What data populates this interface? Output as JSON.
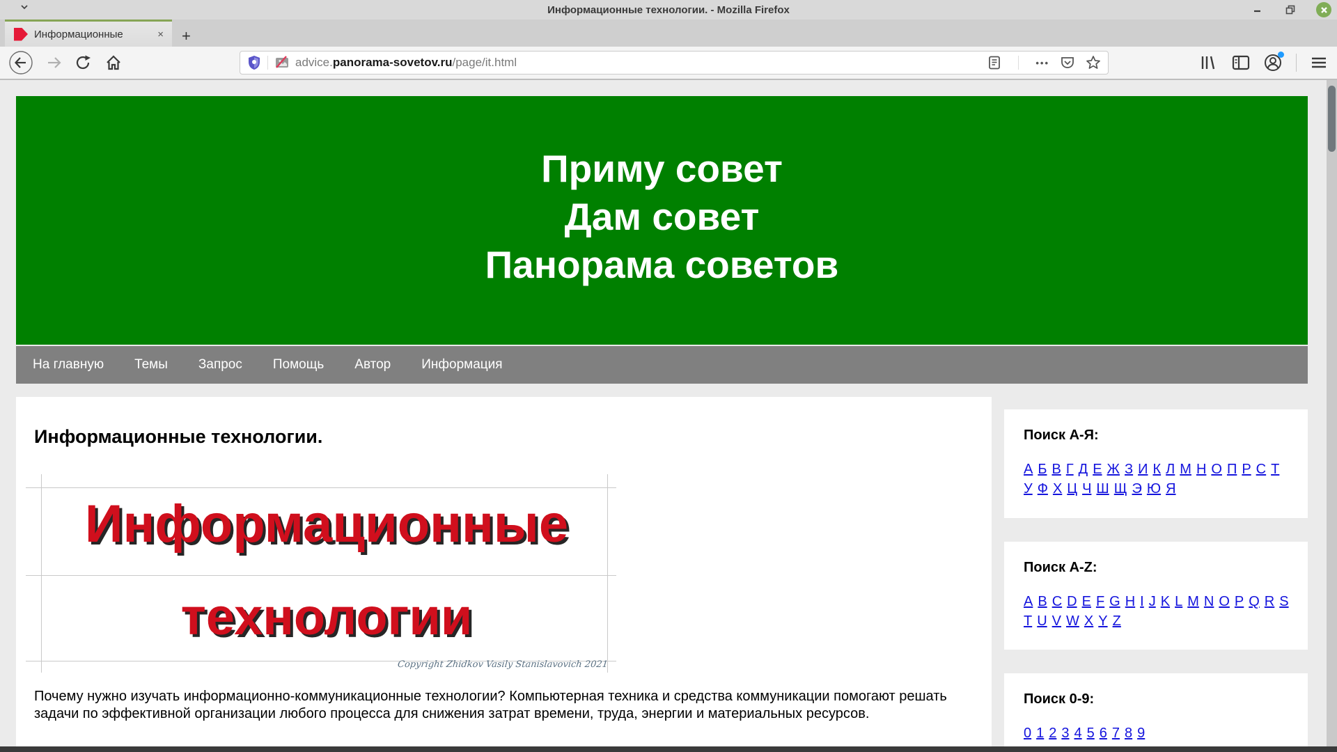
{
  "window": {
    "title": "Информационные технологии. - Mozilla Firefox"
  },
  "tabbar": {
    "active_tab": {
      "title": "Информационные",
      "close_glyph": "×"
    },
    "new_tab_glyph": "+"
  },
  "toolbar": {
    "url": {
      "prefix": "advice.",
      "domain": "panorama-sovetov.ru",
      "path": "/page/it.html"
    },
    "page_actions_glyph": "•••"
  },
  "page": {
    "banner": {
      "bg_color": "#008000",
      "lines": [
        "Приму совет",
        "Дам совет",
        "Панорама советов"
      ]
    },
    "nav": {
      "bg_color": "#808080",
      "items": [
        "На главную",
        "Темы",
        "Запрос",
        "Помощь",
        "Автор",
        "Информация"
      ]
    },
    "article": {
      "heading": "Информационные технологии.",
      "image": {
        "line1": "Информационные",
        "line2": "технологии",
        "text_color": "#d00f1d",
        "signature": "Copyright Zhidkov Vasily Stanislavovich 2021"
      },
      "paragraph": "Почему нужно изучать информационно-коммуникационные технологии? Компьютерная техника и средства коммуникации помогают решать задачи по эффективной организации любого процесса для снижения затрат времени, труда, энергии и материальных ресурсов."
    },
    "sidebar": {
      "link_color": "#1414dd",
      "sections": [
        {
          "title": "Поиск А-Я:",
          "rows": [
            [
              "А",
              "Б",
              "В",
              "Г",
              "Д",
              "Е",
              "Ж",
              "З",
              "И",
              "К",
              "Л",
              "М",
              "Н",
              "О",
              "П",
              "Р",
              "С",
              "Т"
            ],
            [
              "У",
              "Ф",
              "Х",
              "Ц",
              "Ч",
              "Ш",
              "Щ",
              "Э",
              "Ю",
              "Я"
            ]
          ]
        },
        {
          "title": "Поиск A-Z:",
          "rows": [
            [
              "A",
              "B",
              "C",
              "D",
              "E",
              "F",
              "G",
              "H",
              "I",
              "J",
              "K",
              "L",
              "M",
              "N",
              "O",
              "P",
              "Q",
              "R",
              "S"
            ],
            [
              "T",
              "U",
              "V",
              "W",
              "X",
              "Y",
              "Z"
            ]
          ]
        },
        {
          "title": "Поиск 0-9:",
          "rows": [
            [
              "0",
              "1",
              "2",
              "3",
              "4",
              "5",
              "6",
              "7",
              "8",
              "9"
            ]
          ]
        }
      ]
    }
  }
}
